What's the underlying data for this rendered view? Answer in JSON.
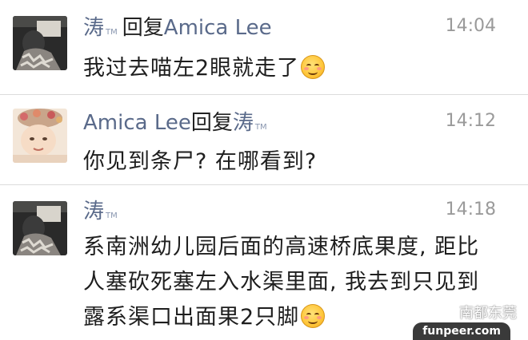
{
  "comments": [
    {
      "author": "涛",
      "author_mark": "TM",
      "reply_word": "回复",
      "reply_target": "Amica Lee",
      "reply_target_mark": "",
      "time": "14:04",
      "text": "我过去喵左2眼就走了",
      "emoji": "smile-emoji"
    },
    {
      "author": "Amica Lee",
      "author_mark": "",
      "reply_word": "回复",
      "reply_target": "涛",
      "reply_target_mark": "TM",
      "time": "14:12",
      "text": "你见到条尸? 在哪看到?"
    },
    {
      "author": "涛",
      "author_mark": "TM",
      "reply_word": "",
      "reply_target": "",
      "time": "14:18",
      "text_lines": [
        "系南洲幼儿园后面的高速桥底果度, 距比",
        "人塞砍死塞左入水渠里面, 我去到只见到",
        "露系渠口出面果2只脚"
      ],
      "emoji": "blush-emoji"
    }
  ],
  "watermark": {
    "text": "南都东莞",
    "icon": "wechat-icon"
  },
  "site_badge": "funpeer.com",
  "colors": {
    "name": "#5a6a8a",
    "time": "#9a9a9a",
    "text": "#1e1e1e",
    "divider": "#dcdcdc"
  }
}
